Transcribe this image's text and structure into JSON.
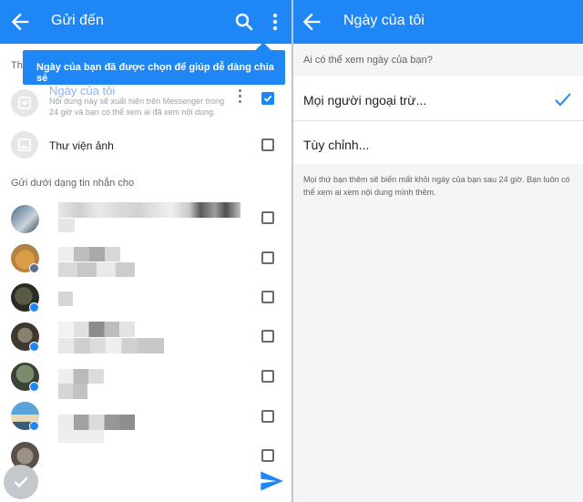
{
  "left_panel": {
    "header": {
      "title": "Gửi đến",
      "back_icon": "arrow-left-icon",
      "search_icon": "search-icon",
      "more_icon": "more-vertical-icon"
    },
    "tooltip": "Ngày của bạn đã được chọn để giúp dễ dàng chia sẻ",
    "section_prefix": "Th",
    "story": {
      "title": "Ngày của tôi",
      "description": "Nội dung này sẽ xuất hiện trên Messenger trong 24 giờ và bạn có thể xem ai đã xem nội dung.",
      "checked": true
    },
    "gallery": {
      "label": "Thư viện ảnh",
      "checked": false
    },
    "message_section_label": "Gửi dưới dạng tin nhắn cho",
    "contacts_checked": [
      false,
      false,
      false,
      false,
      false,
      false,
      false
    ],
    "colors": {
      "accent": "#1f87f5",
      "tooltip_bg": "#1f87f5",
      "checkbox_border": "#6b6b6b"
    }
  },
  "right_panel": {
    "header": {
      "title": "Ngày của tôi",
      "back_icon": "arrow-left-icon"
    },
    "question": "Ai có thể xem ngày của bạn?",
    "options": [
      {
        "label": "Mọi người ngoại trừ...",
        "selected": true
      },
      {
        "label": "Tùy chỉnh...",
        "selected": false
      }
    ],
    "note": "Mọi thứ bạn thêm sẽ biến mất khỏi ngày của bạn sau 24 giờ. Bạn luôn có thể xem ai xem nội dung mình thêm."
  }
}
